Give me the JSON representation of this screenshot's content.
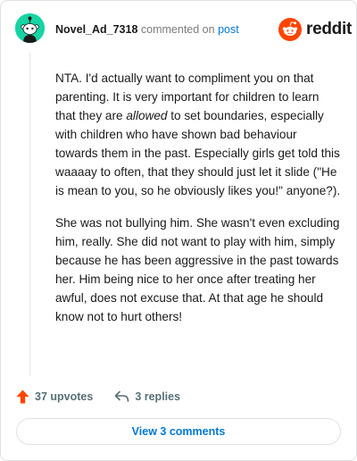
{
  "comment": {
    "username": "Novel_Ad_7318",
    "commented_on_text": "commented on",
    "post_link_text": "post",
    "avatar_icon": "snoo-avatar-icon",
    "avatar_color": "#16d4a4",
    "paragraph1_before": "NTA. I'd actually want to compliment you on that parenting. It is very important for children to learn that they are ",
    "paragraph1_emphasis": "allowed",
    "paragraph1_after": " to set boundaries, especially with children who have shown bad behaviour towards them in the past. Especially girls get told this waaaay to often, that they should just let it slide (\"He is mean to you, so he obviously likes you!\" anyone?).",
    "paragraph2": "She was not bullying him. She wasn't even excluding him, really. She did not want to play with him, simply because he has been aggressive in the past towards her. Him being nice to her once after treating her awful, does not excuse that. At that age he should know not to hurt others!"
  },
  "brand": {
    "logo_icon": "reddit-logo-icon",
    "wordmark": "reddit",
    "accent": "#ff4500"
  },
  "actions": {
    "upvotes_label": "37 upvotes",
    "upvote_icon": "upvote-arrow-icon",
    "replies_label": "3 replies",
    "reply_icon": "reply-arrow-icon"
  },
  "footer": {
    "view_comments_label": "View 3 comments",
    "link_color": "#0079d3"
  }
}
